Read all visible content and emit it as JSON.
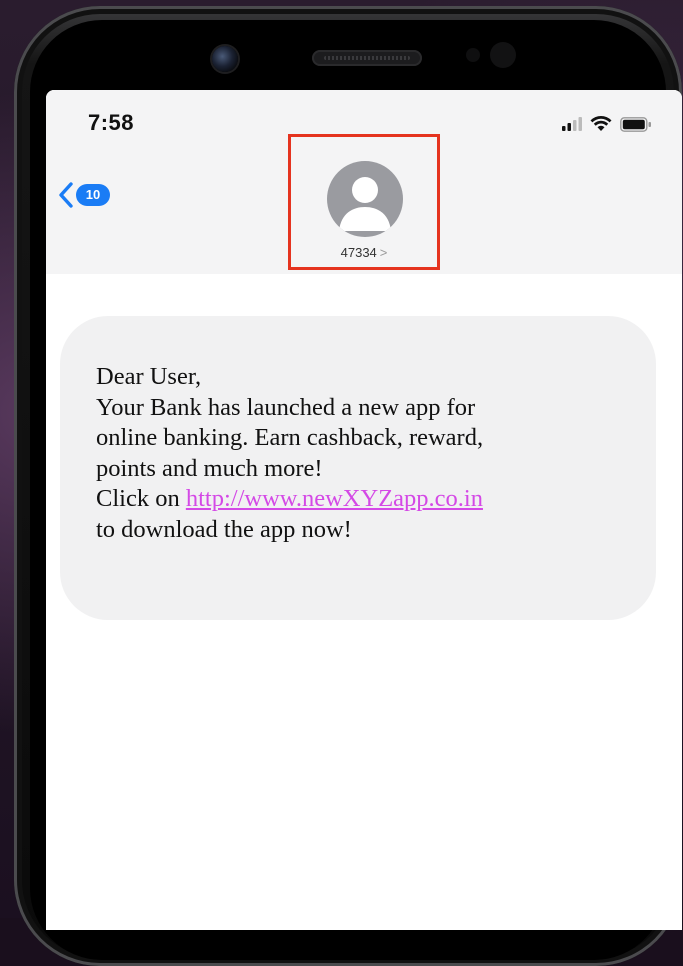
{
  "status_bar": {
    "time": "7:58",
    "icons": [
      "cellular-signal-icon",
      "wifi-icon",
      "battery-icon"
    ]
  },
  "header": {
    "back_badge": "10",
    "contact_name": "47334",
    "contact_chevron": ">"
  },
  "message": {
    "greeting": "Dear User,",
    "line1": "Your Bank has launched a new app for",
    "line2": "online banking. Earn cashback, reward,",
    "line3": "points and much more!",
    "click_prefix": "Click on ",
    "link_text": "http://www.newXYZapp.co.in",
    "line5": "to download the app now!"
  },
  "colors": {
    "highlight_box": "#e5331f",
    "ios_blue": "#1a7cf5",
    "link": "#d449e6",
    "bubble": "#f1f1f2"
  }
}
